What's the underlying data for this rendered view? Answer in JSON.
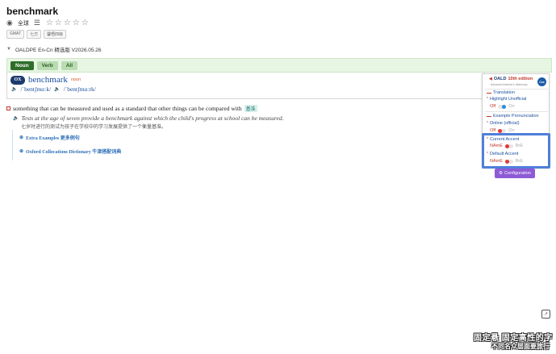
{
  "word": "benchmark",
  "toolbar": {
    "all_label": "全球"
  },
  "tags": [
    "GMAT",
    "七方",
    "馨梧四级"
  ],
  "dictionary": {
    "name": "OALDPE En-Cn 精选版 V2026.05.26"
  },
  "pos_tabs": [
    {
      "label": "Noun",
      "active": true
    },
    {
      "label": "Verb",
      "active": false
    },
    {
      "label": "All",
      "active": false
    }
  ],
  "entry": {
    "icon_text": "OX",
    "headword": "benchmark",
    "pos": "noun",
    "pron_uk": "/ˈbentʃmɑːk/",
    "pron_us": "/ˈbentʃmɑːrk/"
  },
  "sense": {
    "definition": "something that can be measured and used as a standard that other things can be compared with",
    "cn": "基准",
    "example": "Tests at the age of seven provide a benchmark against which the child's progress at school can be measured.",
    "example_cn": "七岁时进行的测试为孩子在学校中的学习发展提供了一个衡量基准。"
  },
  "collapsibles": [
    {
      "label": "Extra Examples 更多例句"
    },
    {
      "label": "Oxford Collocations Dictionary 牛津搭配词典"
    }
  ],
  "panel": {
    "logo": "OALD",
    "edition": "10th edition",
    "subtitle": "Advanced learner's dictionary",
    "badge": "Css",
    "translation_label": "Translation",
    "highlight_label": "Highlight Unofficial",
    "highlight_off": "Off",
    "highlight_on": "On",
    "example_pron_label": "Example Pronunciation",
    "online_label": "Online (official)",
    "online_off": "Off",
    "online_on": "On",
    "current_accent_label": "Current Accent",
    "current_accent_left": "NAmE",
    "current_accent_right": "BrE",
    "default_accent_label": "Default Accent",
    "default_accent_left": "NAmE",
    "default_accent_right": "BrE"
  },
  "config_button": "Configuration",
  "subtitles": {
    "line1": "固定悬 固定高性的字",
    "line2": "不同名众层面要旅行"
  },
  "colors": {
    "accent_blue": "#1a4f9c",
    "pos_green": "#2f6e2a",
    "config_purple": "#8e5ad6",
    "highlight_box": "#4f7fd8",
    "toggle_red": "#e53935",
    "toggle_blue": "#2a8fd8"
  }
}
